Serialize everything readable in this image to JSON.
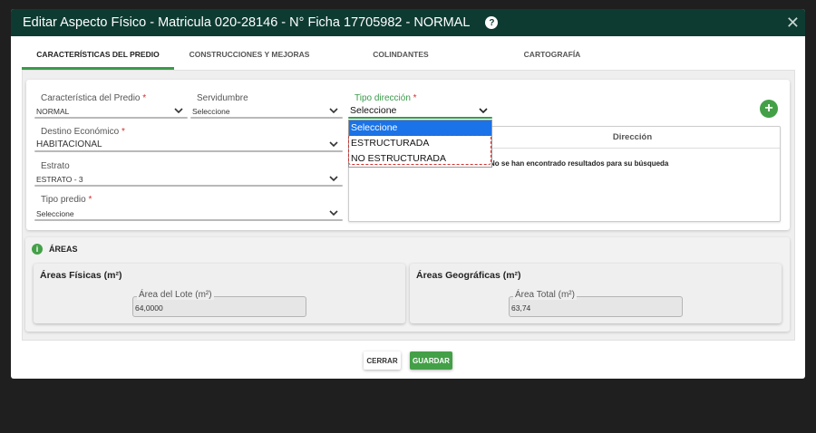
{
  "modal": {
    "title": "Editar Aspecto Físico - Matricula 020-28146 - N° Ficha 17705982 - NORMAL",
    "help_icon": "?",
    "close_icon": "✕"
  },
  "tabs": [
    {
      "label": "CARACTERÍSTICAS DEL PREDIO",
      "active": true
    },
    {
      "label": "CONSTRUCCIONES Y MEJORAS",
      "active": false
    },
    {
      "label": "COLINDANTES",
      "active": false
    },
    {
      "label": "CARTOGRAFÍA",
      "active": false
    }
  ],
  "predio": {
    "caracteristica": {
      "label": "Característica del Predio",
      "required": "*",
      "value": "NORMAL"
    },
    "servidumbre": {
      "label": "Servidumbre",
      "value": "Seleccione"
    },
    "tipo_direccion": {
      "label": "Tipo dirección",
      "required": "*",
      "value": "Seleccione"
    },
    "destino": {
      "label": "Destino Económico",
      "required": "*",
      "value": "HABITACIONAL"
    },
    "estrato": {
      "label": "Estrato",
      "value": "ESTRATO - 3"
    },
    "tipo_predio": {
      "label": "Tipo predio",
      "required": "*",
      "value": "Seleccione"
    }
  },
  "direccion_table": {
    "header": "Dirección",
    "empty_message": "No se han encontrado resultados para su búsqueda"
  },
  "dropdown": {
    "options": [
      "Seleccione",
      "ESTRUCTURADA",
      "NO ESTRUCTURADA"
    ],
    "selected": "Seleccione"
  },
  "areas": {
    "title": "ÁREAS",
    "info_icon": "i",
    "fisicas": {
      "title": "Áreas Físicas (m²)",
      "field_label": "Área del Lote (m²)",
      "value": "64,0000"
    },
    "geograficas": {
      "title": "Áreas Geográficas (m²)",
      "field_label": "Área Total (m²)",
      "value": "63,74"
    }
  },
  "buttons": {
    "cerrar": "CERRAR",
    "guardar": "GUARDAR",
    "add": "+"
  },
  "colors": {
    "header_bg": "#0d3b32",
    "accent_green": "#43a047",
    "dropdown_selected": "#1a73e8",
    "highlight_red": "#d0322e"
  }
}
